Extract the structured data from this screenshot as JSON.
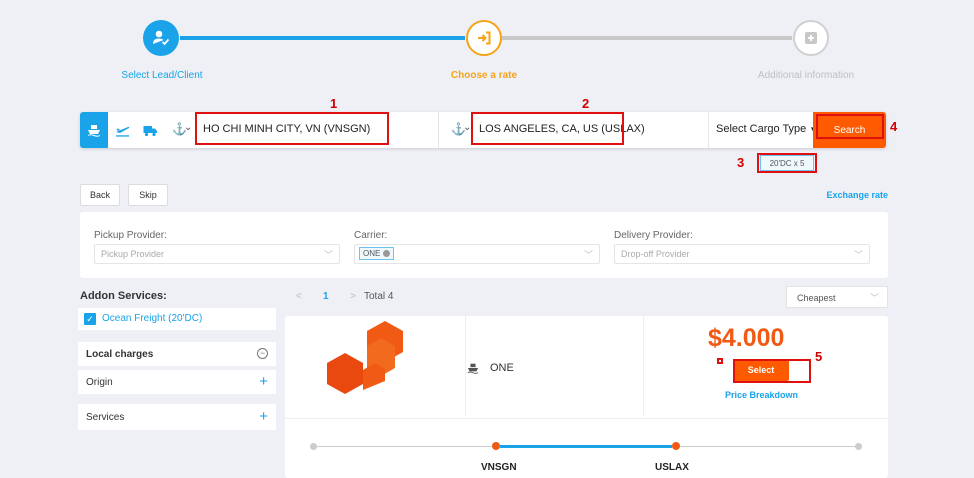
{
  "stepper": {
    "steps": [
      {
        "label": "Select Lead/Client",
        "color": "#1aa3e8"
      },
      {
        "label": "Choose a rate",
        "color": "#f7a318"
      },
      {
        "label": "Additional information",
        "color": "#cccccc"
      }
    ]
  },
  "search": {
    "origin": "HO CHI MINH CITY, VN (VNSGN)",
    "destination": "LOS ANGELES, CA, US (USLAX)",
    "cargo_type": "Select Cargo Type",
    "search_label": "Search",
    "cargo_tag": "20'DC x 5",
    "annotations": [
      "1",
      "2",
      "3",
      "4",
      "5"
    ]
  },
  "actions": {
    "back": "Back",
    "skip": "Skip",
    "exchange_rate": "Exchange rate"
  },
  "filters": {
    "pickup_label": "Pickup Provider:",
    "pickup_placeholder": "Pickup Provider",
    "carrier_label": "Carrier:",
    "carrier_tag": "ONE",
    "delivery_label": "Delivery Provider:",
    "delivery_placeholder": "Drop-off Provider"
  },
  "sidebar": {
    "title": "Addon Services:",
    "ocean_freight": "Ocean Freight (20'DC)",
    "local_charges": "Local charges",
    "origin": "Origin",
    "services": "Services"
  },
  "pagination": {
    "prev": "<",
    "page": "1",
    "next": ">",
    "total": "Total 4",
    "sort": "Cheapest"
  },
  "result": {
    "carrier": "ONE",
    "price": "$4.000",
    "select_label": "Select",
    "price_breakdown": "Price Breakdown",
    "from_port": "VNSGN",
    "to_port": "USLAX"
  },
  "colors": {
    "accent": "#1aa3e8",
    "orange": "#f05a14",
    "search": "#ff5a00",
    "annotation": "#e01010"
  }
}
